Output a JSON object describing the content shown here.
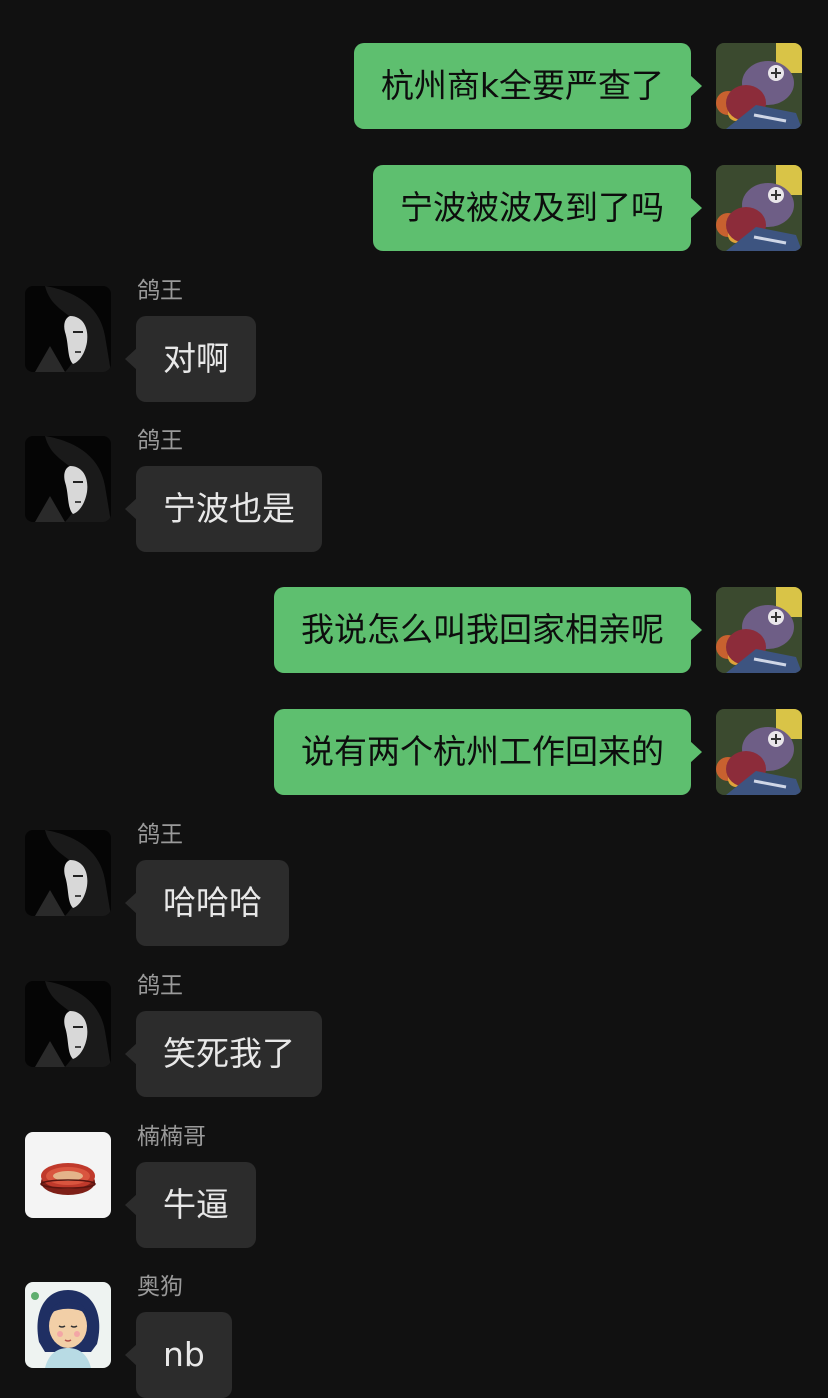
{
  "messages": [
    {
      "side": "out",
      "text": "杭州商k全要严查了"
    },
    {
      "side": "out",
      "text": "宁波被波及到了吗"
    },
    {
      "side": "in",
      "sender": "鸽王",
      "text": "对啊"
    },
    {
      "side": "in",
      "sender": "鸽王",
      "text": "宁波也是"
    },
    {
      "side": "out",
      "text": "我说怎么叫我回家相亲呢"
    },
    {
      "side": "out",
      "text": "说有两个杭州工作回来的"
    },
    {
      "side": "in",
      "sender": "鸽王",
      "text": "哈哈哈"
    },
    {
      "side": "in",
      "sender": "鸽王",
      "text": "笑死我了"
    },
    {
      "side": "in",
      "sender": "楠楠哥",
      "text": "牛逼"
    },
    {
      "side": "in",
      "sender": "奥狗",
      "text": "nb"
    }
  ],
  "colors": {
    "background": "#111111",
    "outgoing_bubble": "#5ebf6f",
    "incoming_bubble": "#2c2c2c",
    "sender_name": "#9a9a9a"
  },
  "icons": {
    "self_avatar": "cartoon-bird-avatar-icon",
    "gewang_avatar": "dark-portrait-avatar-icon",
    "nannange_avatar": "tin-can-avatar-icon",
    "aogou_avatar": "cartoon-girl-avatar-icon"
  }
}
